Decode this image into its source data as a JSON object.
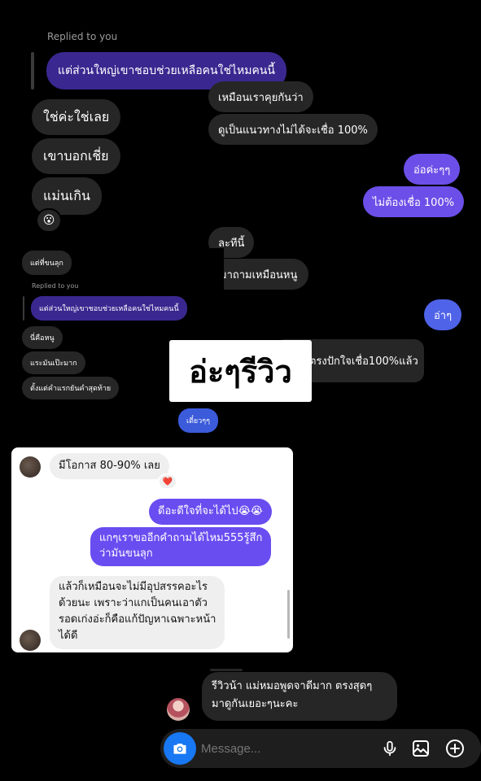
{
  "thread": {
    "replied_label_top": "Replied to you",
    "replied_quote_top": "แต่ส่วนใหญ่เขาชอบช่วยเหลือคนใช่ไหมคนนี้",
    "msg_1": "เหมือนเราคุยกันว่า",
    "msg_2": "ดูเป็นแนวทางไม่ได้จะเชื่อ 100%",
    "msg_3": "ใช่ค่ะใช่เลย",
    "msg_4": "เขาบอกเชี่ย",
    "msg_5": "แม่นเกิน",
    "reaction_1": "😮",
    "msg_6": "อ่อค่ะๆๆ",
    "msg_7": "ไม่ต้องเชื่อ 100%",
    "msg_8": "ละทีนี้",
    "msg_9": "มาถามเหมือนหนู",
    "msg_10": "อ่าๆ",
    "msg_11": "ตรงปักใจเชื่อ100%แล้ว"
  },
  "inset": {
    "msg_a": "แต่ที่ขนลุก",
    "replied_label": "Replied to you",
    "replied_quote": "แต่ส่วนใหญ่เขาชอบช่วยเหลือคนใช่ไหมคนนี้",
    "msg_b": "นี่คือหนู",
    "msg_c": "แระมันเป๊ะมาก",
    "msg_d": "ตั้งแต่คำแรกยันคำสุดท้าย",
    "msg_e": "เดี๋ยวๆๆ"
  },
  "overlay_caption": "อ่ะๆรีวิว",
  "card": {
    "msg_1": "มีโอกาส 80-90% เลย",
    "reaction": "❤️",
    "msg_2": "ดีอะดีใจที่จะได้ไป😭😭",
    "msg_3_line1": "แกๆเราขออีกคำถามได้ไหม555รู้สึก",
    "msg_3_line2": "ว่ามันขนลุก",
    "msg_4_line1": "แล้วก็เหมือนจะไม่มีอุปสรรคอะไร",
    "msg_4_line2": "ด้วยนะ เพราะว่าแกเป็นคนเอาตัว",
    "msg_4_line3": "รอดเก่งอ่ะก็คือแก้ปัญหาเฉพาะหน้า",
    "msg_4_line4": "ได้ดี"
  },
  "bottom": {
    "msg_line1": "รีวิวน้า แม่หมอพูดจาดีมาก ตรงสุดๆ",
    "msg_line2": "มาดูกันเยอะๆนะคะ"
  },
  "composer": {
    "placeholder": "Message...",
    "camera_icon": "camera-icon",
    "mic_icon": "microphone-icon",
    "gallery_icon": "gallery-icon",
    "plus_icon": "plus-icon"
  },
  "colors": {
    "background": "#000000",
    "bubble_grey": "#262626",
    "bubble_purple": "#5b46d6",
    "camera_blue": "#1877f2"
  }
}
